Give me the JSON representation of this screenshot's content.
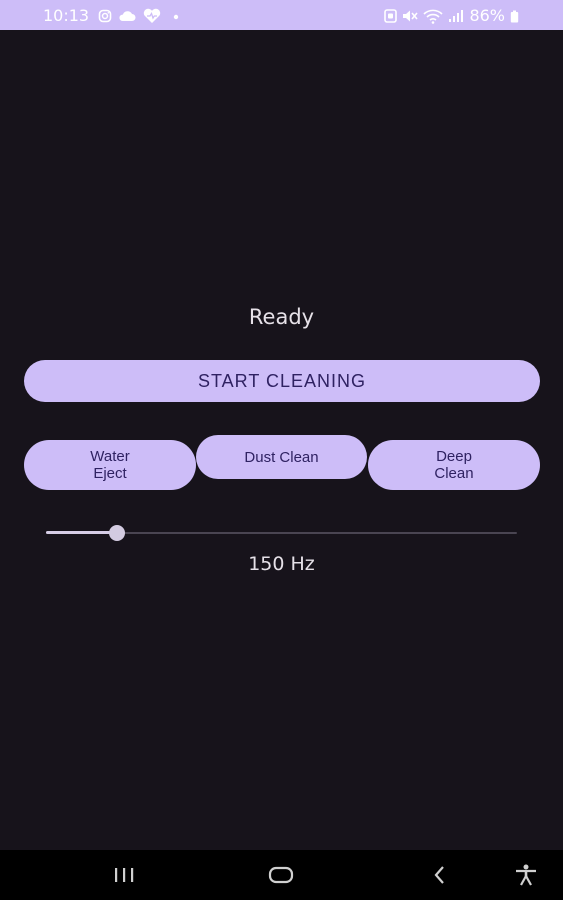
{
  "status_bar": {
    "time": "10:13",
    "battery_percent": "86%",
    "left_icons": [
      "instagram-icon",
      "cloud-icon",
      "heart-icon",
      "dot-icon"
    ],
    "right_icons": [
      "nfc-icon",
      "mute-icon",
      "wifi-icon",
      "signal-icon",
      "battery-icon"
    ]
  },
  "main": {
    "status_text": "Ready",
    "start_button_label": "START CLEANING",
    "modes": [
      {
        "line1": "Water",
        "line2": "Eject"
      },
      {
        "line1": "Dust Clean",
        "line2": ""
      },
      {
        "line1": "Deep",
        "line2": "Clean"
      }
    ],
    "frequency": {
      "value": 150,
      "min": 0,
      "max": 1000,
      "label": "150 Hz"
    }
  },
  "nav_bar": {
    "icons": [
      "recents-icon",
      "home-icon",
      "back-icon",
      "accessibility-icon"
    ]
  },
  "colors": {
    "background": "#17131b",
    "accent": "#cdbdf8",
    "accent_text": "#2f2262",
    "text": "#e6e1e8"
  }
}
